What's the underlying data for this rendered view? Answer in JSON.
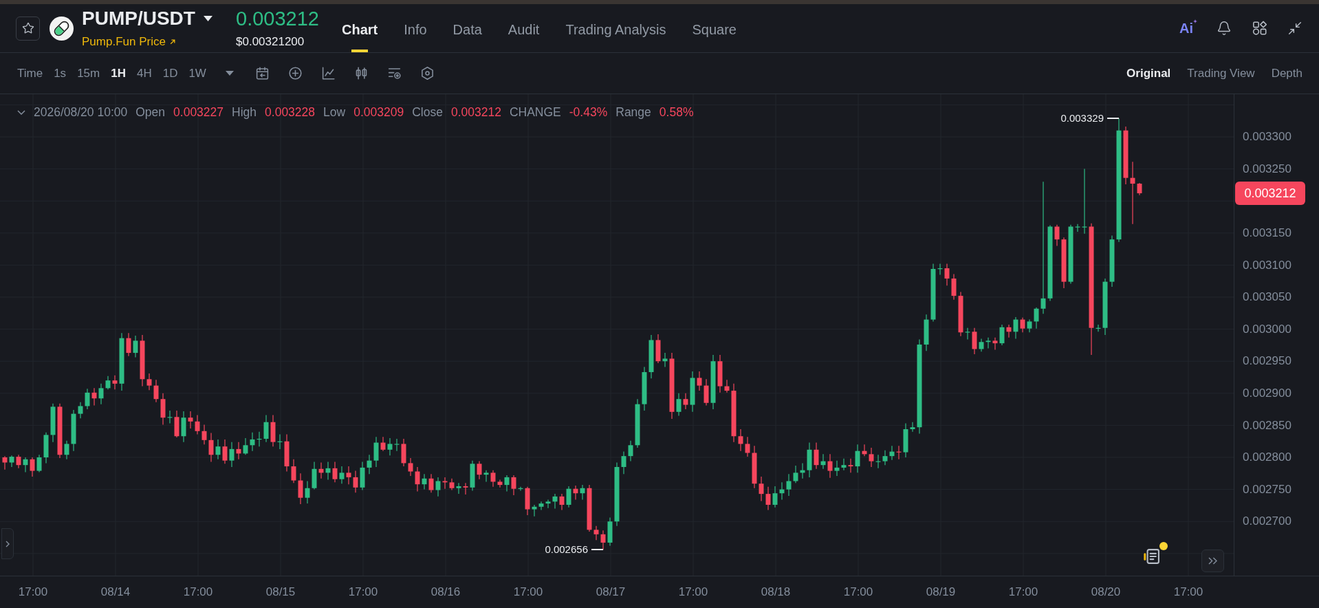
{
  "header": {
    "favorite": false,
    "pair": "PUMP/USDT",
    "price_link": "Pump.Fun Price",
    "last_price": "0.003212",
    "last_price_rising": true,
    "usd_price": "$0.00321200",
    "tabs": [
      {
        "label": "Chart",
        "selected": true
      },
      {
        "label": "Info",
        "selected": false
      },
      {
        "label": "Data",
        "selected": false
      },
      {
        "label": "Audit",
        "selected": false
      },
      {
        "label": "Trading Analysis",
        "selected": false
      },
      {
        "label": "Square",
        "selected": false
      }
    ],
    "ai_label": "Ai"
  },
  "toolbar": {
    "intervals": [
      {
        "label": "Time",
        "selected": false
      },
      {
        "label": "1s",
        "selected": false
      },
      {
        "label": "15m",
        "selected": false
      },
      {
        "label": "1H",
        "selected": true
      },
      {
        "label": "4H",
        "selected": false
      },
      {
        "label": "1D",
        "selected": false
      },
      {
        "label": "1W",
        "selected": false
      }
    ],
    "views": [
      {
        "label": "Original",
        "selected": true
      },
      {
        "label": "Trading View",
        "selected": false
      },
      {
        "label": "Depth",
        "selected": false
      }
    ]
  },
  "legend": {
    "datetime": "2026/08/20 10:00",
    "rising": false,
    "fields": [
      {
        "label": "Open",
        "value": "0.003227"
      },
      {
        "label": "High",
        "value": "0.003228"
      },
      {
        "label": "Low",
        "value": "0.003209"
      },
      {
        "label": "Close",
        "value": "0.003212"
      },
      {
        "label": "CHANGE",
        "value": "-0.43%"
      },
      {
        "label": "Range",
        "value": "0.58%"
      }
    ]
  },
  "chart": {
    "high_label": "0.003329",
    "low_label": "0.002656",
    "news_unread": true
  },
  "price_axis": {
    "ticks": [
      "0.003300",
      "0.003250",
      "0.003150",
      "0.003100",
      "0.003050",
      "0.003000",
      "0.002950",
      "0.002900",
      "0.002850",
      "0.002800",
      "0.002750",
      "0.002700"
    ],
    "current_price": "0.003212",
    "current_rising": false
  },
  "time_axis": {
    "ticks": [
      "17:00",
      "08/14",
      "17:00",
      "08/15",
      "17:00",
      "08/16",
      "17:00",
      "08/17",
      "17:00",
      "08/18",
      "17:00",
      "08/19",
      "17:00",
      "08/20",
      "17:00"
    ]
  }
}
